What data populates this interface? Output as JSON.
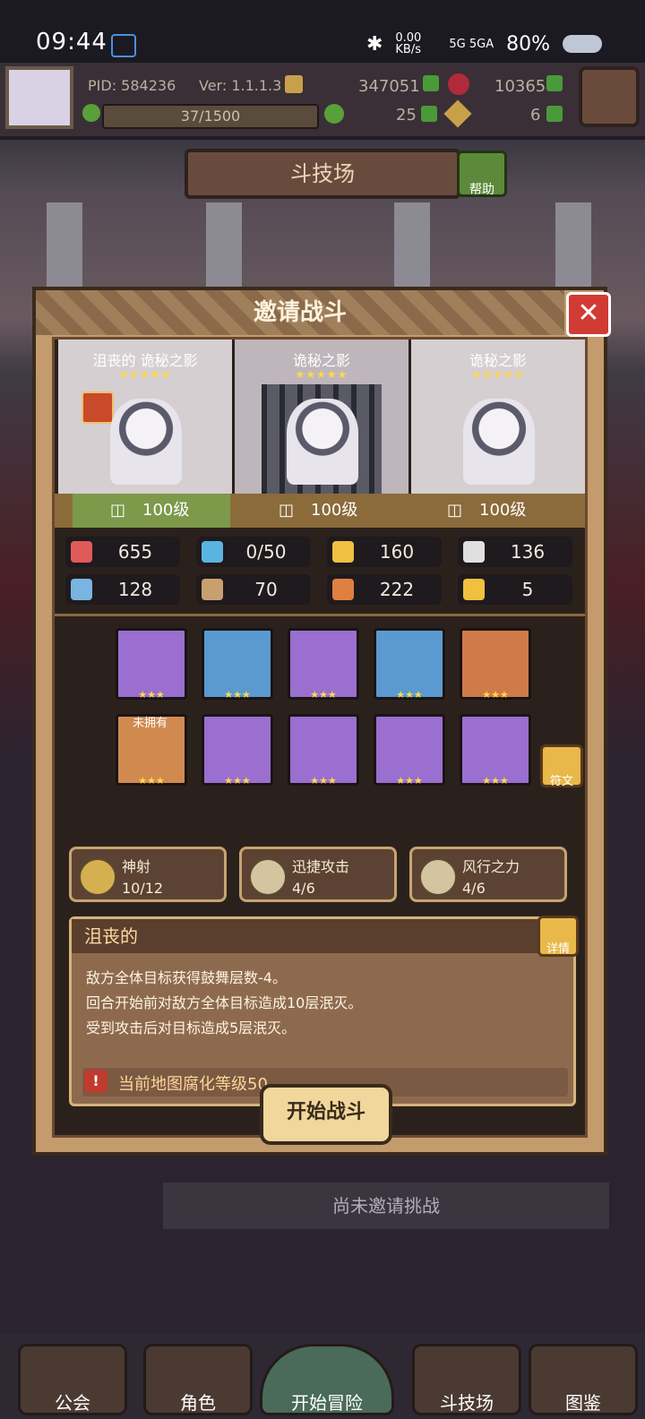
{
  "status_bar": {
    "time": "09:44",
    "speed": "0.00 KB/s",
    "network": "5G 5GA",
    "battery": "80%"
  },
  "player": {
    "pid": "PID: 584236",
    "version": "Ver: 1.1.1.3",
    "gold": "347051",
    "gems": "10365",
    "energy": "37/1500",
    "clover": "25",
    "keys": "6"
  },
  "header": {
    "title": "斗技场",
    "help_label": "帮助"
  },
  "dialog": {
    "title": "邀请战斗",
    "characters": [
      {
        "name": "沮丧的 诡秘之影",
        "stars": "★★★★★",
        "level": "100级"
      },
      {
        "name": "诡秘之影",
        "stars": "★★★★★",
        "level": "100级"
      },
      {
        "name": "诡秘之影",
        "stars": "★★★★★",
        "level": "100级"
      }
    ],
    "stats": [
      {
        "icon": "heart-icon",
        "value": "655",
        "color": "#e05a5a"
      },
      {
        "icon": "water-drop-icon",
        "value": "0/50",
        "color": "#5ab4e0"
      },
      {
        "icon": "shield-icon",
        "value": "160",
        "color": "#f0c040"
      },
      {
        "icon": "wing-icon",
        "value": "136",
        "color": "#e0e0e0"
      },
      {
        "icon": "fist-icon",
        "value": "128",
        "color": "#7ab4e0"
      },
      {
        "icon": "book-icon",
        "value": "70",
        "color": "#c8a070"
      },
      {
        "icon": "card-icon",
        "value": "222",
        "color": "#e08040"
      },
      {
        "icon": "horseshoe-icon",
        "value": "5",
        "color": "#f0c040"
      }
    ],
    "equipment_row1": [
      {
        "name": "bow-icon",
        "stars": "★★★",
        "bg": "#9a6fd0"
      },
      {
        "name": "arrow-icon",
        "stars": "★★★",
        "bg": "#5a9ad0"
      },
      {
        "name": "necklace-icon",
        "stars": "★★★",
        "bg": "#9a6fd0"
      },
      {
        "name": "ring-icon",
        "stars": "★★★",
        "bg": "#5a9ad0"
      },
      {
        "name": "crown-amulet-icon",
        "stars": "★★★",
        "bg": "#d07a4a"
      }
    ],
    "equipment_row2": [
      {
        "name": "helmet-icon",
        "stars": "★★★",
        "bg": "#d08a50",
        "tag": "未拥有"
      },
      {
        "name": "armor-icon",
        "stars": "★★★",
        "bg": "#9a6fd0"
      },
      {
        "name": "gloves-icon",
        "stars": "★★★",
        "bg": "#9a6fd0"
      },
      {
        "name": "belt-icon",
        "stars": "★★★",
        "bg": "#9a6fd0"
      },
      {
        "name": "boots-icon",
        "stars": "★★★",
        "bg": "#9a6fd0"
      }
    ],
    "rune_label": "符文",
    "skills": [
      {
        "name": "神射",
        "count": "10/12"
      },
      {
        "name": "迅捷攻击",
        "count": "4/6"
      },
      {
        "name": "风行之力",
        "count": "4/6"
      }
    ],
    "desc": {
      "title": "沮丧的",
      "details_label": "详情",
      "lines": [
        "敌方全体目标获得鼓舞层数-4。",
        "回合开始前对敌方全体目标造成10层泯灭。",
        "受到攻击后对目标造成5层泯灭。"
      ],
      "warning": "当前地图腐化等级50"
    },
    "start_button": "开始战斗"
  },
  "arena": {
    "no_invite": "尚未邀请挑战"
  },
  "nav": [
    "公会",
    "角色",
    "开始冒险",
    "斗技场",
    "图鉴"
  ]
}
